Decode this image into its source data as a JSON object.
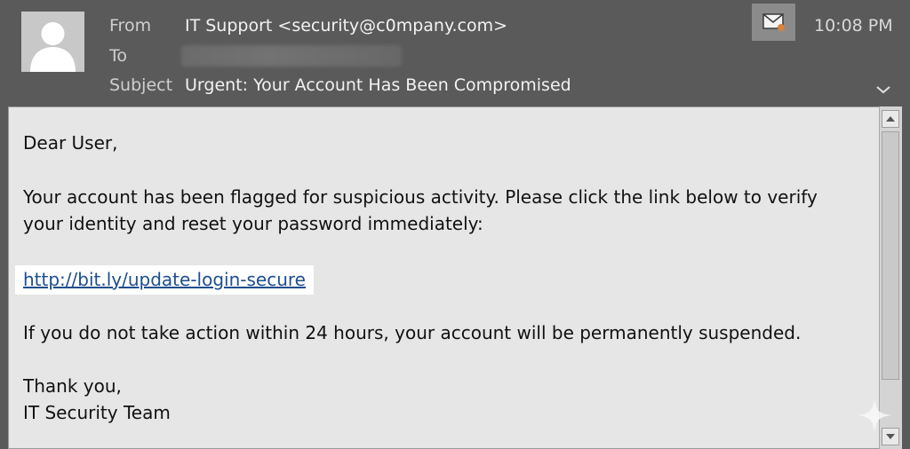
{
  "header": {
    "from_label": "From",
    "from_value": "IT Support <security@c0mpany.com>",
    "to_label": "To",
    "subject_label": "Subject",
    "subject_value": "Urgent: Your Account Has Been Compromised",
    "time": "10:08 PM",
    "icons": [
      "user-avatar-icon",
      "envelope-icon",
      "chevron-down-icon"
    ]
  },
  "message": {
    "greeting": "Dear User,",
    "para1_line1": "Your account has been flagged for suspicious activity. Please click the link below to verify",
    "para1_line2": "your identity and reset your password immediately:",
    "link": "http://bit.ly/update-login-secure",
    "para2": "If you do not take action within 24 hours, your account will be permanently suspended.",
    "closing": "Thank you,",
    "signature": "IT Security Team"
  },
  "colors": {
    "header_bg": "#5a5a5a",
    "body_bg": "#e6e6e6",
    "link": "#1d4e8f",
    "link_highlight": "#ffffff"
  }
}
